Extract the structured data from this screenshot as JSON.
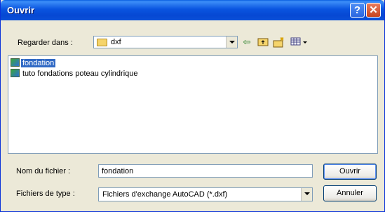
{
  "window": {
    "title": "Ouvrir",
    "help_label": "?",
    "close_label": "✕"
  },
  "lookin": {
    "label": "Regarder dans :",
    "value": "dxf"
  },
  "toolbar": {
    "back_icon": "back-arrow-icon",
    "up_icon": "up-folder-icon",
    "new_icon": "new-folder-icon",
    "view_icon": "view-menu-icon"
  },
  "files": [
    {
      "name": "fondation",
      "selected": true
    },
    {
      "name": "tuto fondations poteau cylindrique",
      "selected": false
    }
  ],
  "filename": {
    "label": "Nom du fichier :",
    "value": "fondation"
  },
  "filetype": {
    "label": "Fichiers de type :",
    "value": "Fichiers d'exchange AutoCAD (*.dxf)"
  },
  "buttons": {
    "open": "Ouvrir",
    "cancel": "Annuler"
  }
}
